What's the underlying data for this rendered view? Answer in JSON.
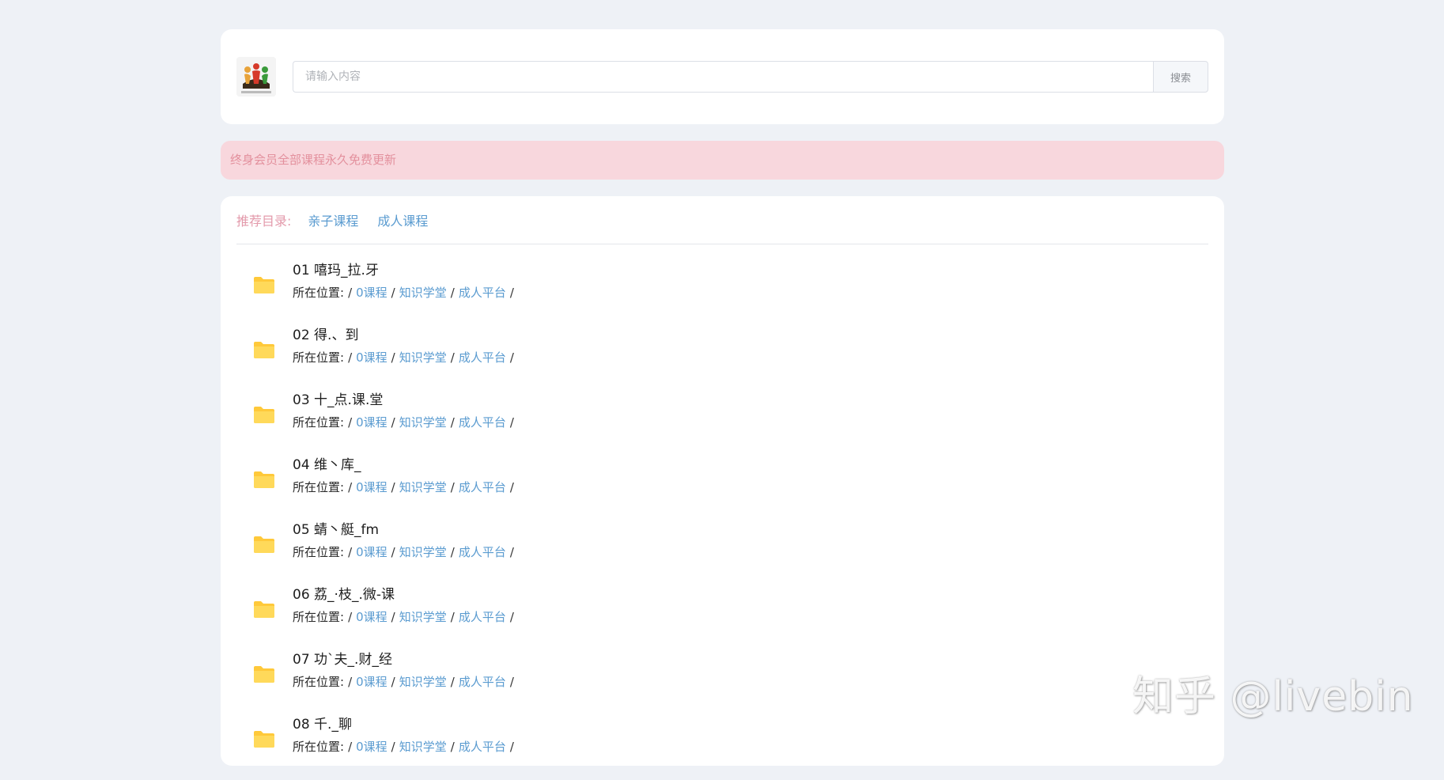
{
  "search": {
    "placeholder": "请输入内容",
    "button_label": "搜索"
  },
  "notice": "终身会员全部课程永久免费更新",
  "categories": {
    "label": "推荐目录:",
    "links": [
      "亲子课程",
      "成人课程"
    ]
  },
  "path_label": "所在位置:",
  "path_separator": "/",
  "items": [
    {
      "title": "01 嘻玛_拉.牙",
      "path": [
        "0课程",
        "知识学堂",
        "成人平台"
      ]
    },
    {
      "title": "02 得.、到",
      "path": [
        "0课程",
        "知识学堂",
        "成人平台"
      ]
    },
    {
      "title": "03 十_点.课.堂",
      "path": [
        "0课程",
        "知识学堂",
        "成人平台"
      ]
    },
    {
      "title": "04 维丶库_",
      "path": [
        "0课程",
        "知识学堂",
        "成人平台"
      ]
    },
    {
      "title": "05 蜻丶艇_fm",
      "path": [
        "0课程",
        "知识学堂",
        "成人平台"
      ]
    },
    {
      "title": "06 荔_·枝_.微-课",
      "path": [
        "0课程",
        "知识学堂",
        "成人平台"
      ]
    },
    {
      "title": "07 功`夫_.财_经",
      "path": [
        "0课程",
        "知识学堂",
        "成人平台"
      ]
    },
    {
      "title": "08 千._聊",
      "path": [
        "0课程",
        "知识学堂",
        "成人平台"
      ]
    }
  ],
  "watermark": "知乎 @livebin",
  "colors": {
    "folder": "#ffd24d",
    "link": "#5a9bd0",
    "notice_bg": "#f8d7dd",
    "notice_text": "#e3909d"
  }
}
